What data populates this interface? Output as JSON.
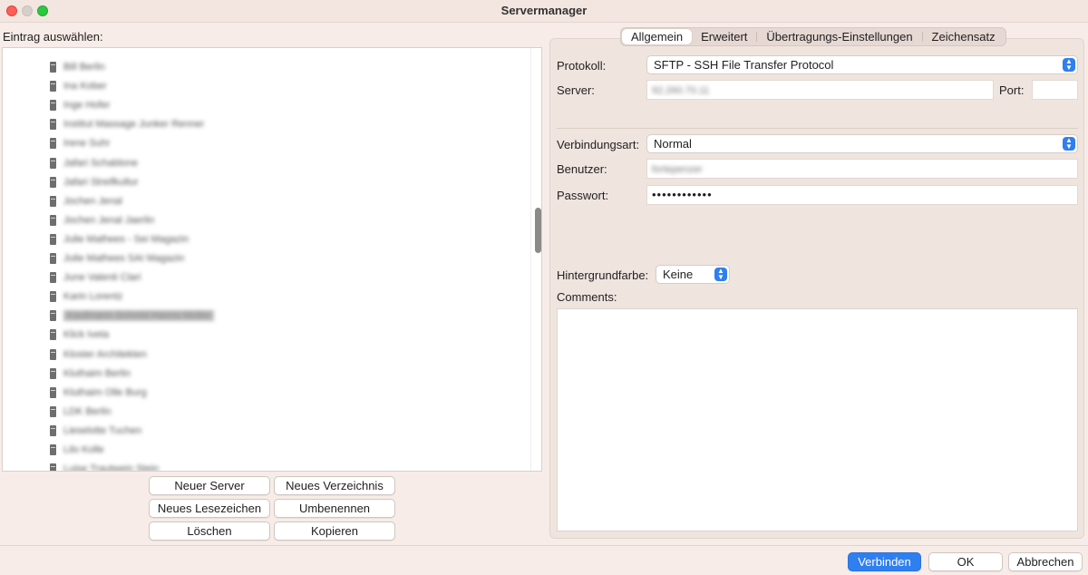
{
  "window": {
    "title": "Servermanager"
  },
  "left": {
    "select_label": "Eintrag auswählen:",
    "tree_items": [
      "Bill Berlin",
      "Ina Kober",
      "Inge Hofer",
      "Institut Massage Junker Renner",
      "Irene Suhr",
      "Jafari Schablone",
      "Jafari Streifkultur",
      "Jochen Jenal",
      "Jochen Jenal Jaerlin",
      "Julie Mathees - Sei Magazin",
      "Julie Mathees SAI Magazin",
      "June Valenti Clari",
      "Karin Lorentz",
      "Kaufmann Schmid Hanno Müller",
      "Klick Iveta",
      "Kloster Architekten",
      "Kluthaim Berlin",
      "Kluthaim Olle Burg",
      "LDK Berlin",
      "Lieselotte Tuchen",
      "Lilo Kolle",
      "Luise Trautwein Stein"
    ],
    "buttons": {
      "new_server": "Neuer Server",
      "new_folder": "Neues Verzeichnis",
      "new_bookmark": "Neues Lesezeichen",
      "rename": "Umbenennen",
      "delete": "Löschen",
      "copy": "Kopieren"
    }
  },
  "tabs": [
    "Allgemein",
    "Erweitert",
    "Übertragungs-Einstellungen",
    "Zeichensatz"
  ],
  "form": {
    "protocol_label": "Protokoll:",
    "protocol_value": "SFTP - SSH File Transfer Protocol",
    "server_label": "Server:",
    "server_value": "92.260.70.11",
    "port_label": "Port:",
    "port_value": "",
    "connection_type_label": "Verbindungsart:",
    "connection_type_value": "Normal",
    "user_label": "Benutzer:",
    "user_value": "fortepenzer",
    "password_label": "Passwort:",
    "password_value": "••••••••••••",
    "bgcolor_label": "Hintergrundfarbe:",
    "bgcolor_value": "Keine",
    "comments_label": "Comments:",
    "comments_value": ""
  },
  "footer": {
    "connect": "Verbinden",
    "ok": "OK",
    "cancel": "Abbrechen"
  },
  "colors": {
    "accent": "#2f7ff0",
    "window_bg": "#f7ece7"
  }
}
